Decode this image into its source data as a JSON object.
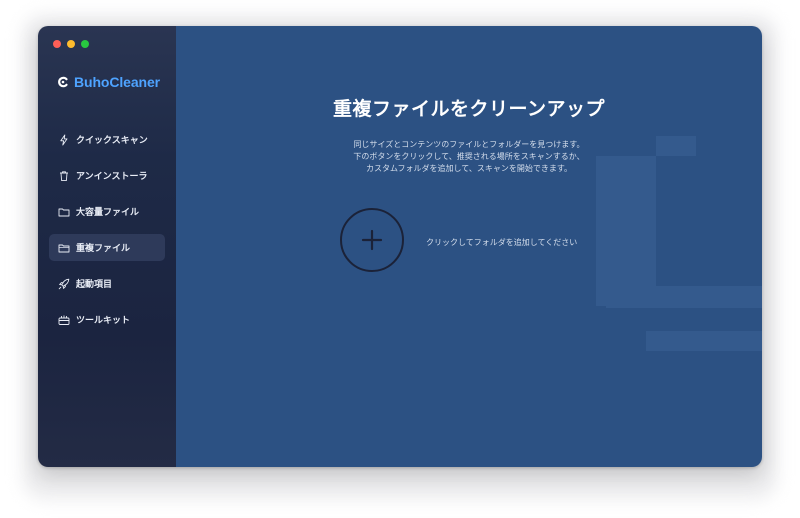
{
  "app": {
    "name": "BuhoCleaner"
  },
  "sidebar": {
    "items": [
      {
        "label": "クイックスキャン",
        "icon": "lightning-icon",
        "active": false
      },
      {
        "label": "アンインストーラ",
        "icon": "trash-icon",
        "active": false
      },
      {
        "label": "大容量ファイル",
        "icon": "folder-icon",
        "active": false
      },
      {
        "label": "重複ファイル",
        "icon": "duplicate-folder-icon",
        "active": true
      },
      {
        "label": "起動項目",
        "icon": "rocket-icon",
        "active": false
      },
      {
        "label": "ツールキット",
        "icon": "toolkit-icon",
        "active": false
      }
    ]
  },
  "main": {
    "title": "重複ファイルをクリーンアップ",
    "description": [
      "同じサイズとコンテンツのファイルとフォルダーを見つけます。",
      "下のボタンをクリックして、推奨される場所をスキャンするか、",
      "カスタムフォルダを追加して、スキャンを開始できます。"
    ],
    "add_label": "クリックしてフォルダを追加してください"
  },
  "colors": {
    "brand": "#4ea3ff",
    "main_bg": "#2c5183",
    "sidebar_bg": "#1e2a47"
  }
}
